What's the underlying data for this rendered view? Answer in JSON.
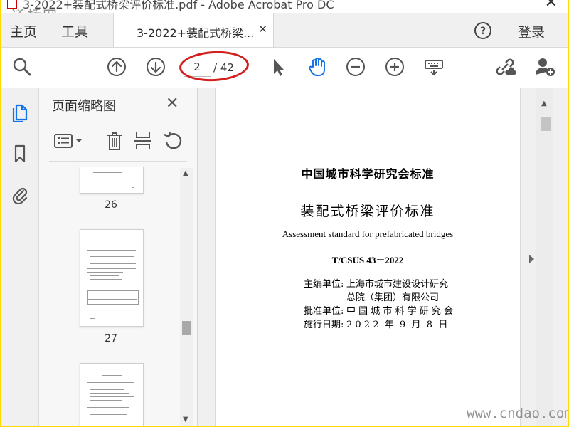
{
  "window": {
    "title": "3-2022+装配式桥梁评价标准.pdf - Adobe Acrobat Pro DC",
    "close_glyph": "✕"
  },
  "watermark": {
    "top": "道桥网",
    "bottom": "www.cndao.com"
  },
  "tabs": {
    "home": "主页",
    "tools": "工具",
    "document": "3-2022+装配式桥梁...",
    "close_glyph": "✕"
  },
  "header": {
    "login": "登录",
    "help_icon": "question-circle-icon"
  },
  "toolbar": {
    "current_page": "2",
    "total_pages": "/ 42",
    "icons": [
      "search-icon",
      "page-up-icon",
      "page-down-icon",
      "select-arrow-icon",
      "hand-icon",
      "zoom-out-icon",
      "zoom-in-icon",
      "keyboard-icon",
      "share-link-icon",
      "add-user-icon"
    ],
    "accent_color": "#1473e6",
    "highlight_color": "#d41f1f"
  },
  "left_rail": {
    "icons": [
      "pages-icon",
      "bookmark-icon",
      "attachment-icon"
    ]
  },
  "thumbnail_panel": {
    "title": "页面缩略图",
    "close_glyph": "✕",
    "tools": [
      "thumbnail-options-icon",
      "delete-icon",
      "insert-page-icon",
      "rotate-icon"
    ],
    "thumbnails": [
      {
        "label": "26"
      },
      {
        "label": "27"
      }
    ]
  },
  "document": {
    "organization": "中国城市科学研究会标准",
    "title": "装配式桥梁评价标准",
    "english_title": "Assessment standard for prefabricated bridges",
    "code": "T/CSUS 43－2022",
    "editor_label": "主编单位:",
    "editor_line1": "上海市城市建设设计研究",
    "editor_line2": "总院（集团）有限公司",
    "approver_label": "批准单位:",
    "approver": "中 国 城 市 科 学 研 究 会",
    "date_label": "施行日期:",
    "date": "2 0 2 2  年  9  月  8  日"
  }
}
